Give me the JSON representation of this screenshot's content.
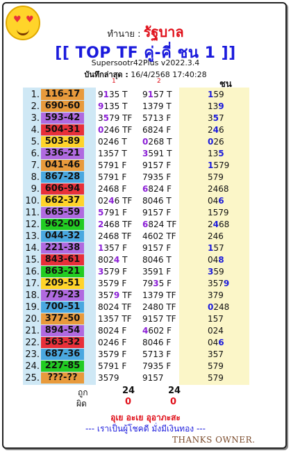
{
  "header": {
    "predictor_label": "ทำนาย :",
    "predictor_name": "รัฐบาล",
    "title": "[[ TOP TF คู่-คี่ ชน 1 ]]",
    "version": "Supersootr42Plus v2022.3.4",
    "saved_label": "บันทึกล่าสุด :",
    "saved_time": "16/4/2568 17:40:28",
    "col1_num": "1",
    "col2_num": "2",
    "chon_label": "ชน"
  },
  "rows": [
    {
      "idx": "1.",
      "pair": "116-17",
      "color": "#e89a3c",
      "c1": [
        [
          "9",
          0
        ],
        [
          "1",
          1
        ],
        [
          "35 T",
          0
        ]
      ],
      "c2": [
        [
          "9",
          0
        ],
        [
          "1",
          1
        ],
        [
          "57 T",
          0
        ]
      ],
      "c3": [
        [
          "1",
          1
        ],
        [
          "59",
          0
        ]
      ]
    },
    {
      "idx": "2.",
      "pair": "690-60",
      "color": "#e89a3c",
      "c1": [
        [
          "9",
          1
        ],
        [
          "135 T",
          0
        ]
      ],
      "c2": [
        [
          "1379 T",
          0
        ]
      ],
      "c3": [
        [
          "13",
          0
        ],
        [
          "9",
          1
        ]
      ]
    },
    {
      "idx": "3.",
      "pair": "593-42",
      "color": "#b06ae0",
      "c1": [
        [
          "3",
          0
        ],
        [
          "5",
          1
        ],
        [
          "79 TF",
          0
        ]
      ],
      "c2": [
        [
          "5713 F",
          0
        ]
      ],
      "c3": [
        [
          "3",
          0
        ],
        [
          "5",
          1
        ],
        [
          "7",
          0
        ]
      ]
    },
    {
      "idx": "4.",
      "pair": "504-31",
      "color": "#e8303a",
      "c1": [
        [
          "0",
          1
        ],
        [
          "246 TF",
          0
        ]
      ],
      "c2": [
        [
          "6824 F",
          0
        ]
      ],
      "c3": [
        [
          "2",
          0
        ],
        [
          "4",
          1
        ],
        [
          "6",
          0
        ]
      ]
    },
    {
      "idx": "5.",
      "pair": "503-89",
      "color": "#ffd42a",
      "c1": [
        [
          "0246 T",
          0
        ]
      ],
      "c2": [
        [
          "0",
          1
        ],
        [
          "268 T",
          0
        ]
      ],
      "c3": [
        [
          "0",
          1
        ],
        [
          "26",
          0
        ]
      ]
    },
    {
      "idx": "6.",
      "pair": "336-21",
      "color": "#b06ae0",
      "c1": [
        [
          "1357 T",
          0
        ]
      ],
      "c2": [
        [
          "3",
          1
        ],
        [
          "591 T",
          0
        ]
      ],
      "c3": [
        [
          "13",
          0
        ],
        [
          "5",
          1
        ]
      ]
    },
    {
      "idx": "7.",
      "pair": "041-46",
      "color": "#e89a3c",
      "c1": [
        [
          "5791 F",
          0
        ]
      ],
      "c2": [
        [
          "9157 F",
          0
        ]
      ],
      "c3": [
        [
          "1",
          1
        ],
        [
          "579",
          0
        ]
      ]
    },
    {
      "idx": "8.",
      "pair": "867-28",
      "color": "#4aa8e0",
      "c1": [
        [
          "5791 F",
          0
        ]
      ],
      "c2": [
        [
          "7935 F",
          0
        ]
      ],
      "c3": [
        [
          "579",
          0
        ]
      ]
    },
    {
      "idx": "9.",
      "pair": "606-94",
      "color": "#e8303a",
      "c1": [
        [
          "2468 F",
          0
        ]
      ],
      "c2": [
        [
          "6",
          1
        ],
        [
          "824 F",
          0
        ]
      ],
      "c3": [
        [
          "2468",
          0
        ]
      ]
    },
    {
      "idx": "10.",
      "pair": "662-37",
      "color": "#ffd42a",
      "c1": [
        [
          "02",
          0
        ],
        [
          "4",
          1
        ],
        [
          "6 TF",
          0
        ]
      ],
      "c2": [
        [
          "8046 T",
          0
        ]
      ],
      "c3": [
        [
          "04",
          0
        ],
        [
          "6",
          1
        ]
      ]
    },
    {
      "idx": "11.",
      "pair": "665-59",
      "color": "#b06ae0",
      "c1": [
        [
          "5",
          1
        ],
        [
          "791 F",
          0
        ]
      ],
      "c2": [
        [
          "9157 F",
          0
        ]
      ],
      "c3": [
        [
          "1579",
          0
        ]
      ]
    },
    {
      "idx": "12.",
      "pair": "962-00",
      "color": "#22cc22",
      "c1": [
        [
          "2",
          1
        ],
        [
          "468 TF",
          0
        ]
      ],
      "c2": [
        [
          "6",
          1
        ],
        [
          "824 TF",
          0
        ]
      ],
      "c3": [
        [
          "2",
          0
        ],
        [
          "4",
          1
        ],
        [
          "68",
          0
        ]
      ]
    },
    {
      "idx": "13.",
      "pair": "044-32",
      "color": "#4aa8e0",
      "c1": [
        [
          "2468 TF",
          0
        ]
      ],
      "c2": [
        [
          "4602 TF",
          0
        ]
      ],
      "c3": [
        [
          "246",
          0
        ]
      ]
    },
    {
      "idx": "14.",
      "pair": "221-38",
      "color": "#b06ae0",
      "c1": [
        [
          "1",
          1
        ],
        [
          "357 F",
          0
        ]
      ],
      "c2": [
        [
          "9157 F",
          0
        ]
      ],
      "c3": [
        [
          "1",
          1
        ],
        [
          "57",
          0
        ]
      ]
    },
    {
      "idx": "15.",
      "pair": "843-61",
      "color": "#e8303a",
      "c1": [
        [
          "802",
          0
        ],
        [
          "4",
          1
        ],
        [
          " T",
          0
        ]
      ],
      "c2": [
        [
          "8046 T",
          0
        ]
      ],
      "c3": [
        [
          "04",
          0
        ],
        [
          "8",
          1
        ]
      ]
    },
    {
      "idx": "16.",
      "pair": "863-21",
      "color": "#22cc22",
      "c1": [
        [
          "3",
          1
        ],
        [
          "579 F",
          0
        ]
      ],
      "c2": [
        [
          "3591 F",
          0
        ]
      ],
      "c3": [
        [
          "3",
          1
        ],
        [
          "59",
          0
        ]
      ]
    },
    {
      "idx": "17.",
      "pair": "209-51",
      "color": "#ffd42a",
      "c1": [
        [
          "3579 F",
          0
        ]
      ],
      "c2": [
        [
          "79",
          0
        ],
        [
          "3",
          1
        ],
        [
          "5 F",
          0
        ]
      ],
      "c3": [
        [
          "357",
          0
        ],
        [
          "9",
          1
        ]
      ]
    },
    {
      "idx": "18.",
      "pair": "779-23",
      "color": "#b06ae0",
      "c1": [
        [
          "357",
          0
        ],
        [
          "9",
          1
        ],
        [
          " TF",
          0
        ]
      ],
      "c2": [
        [
          "1379 TF",
          0
        ]
      ],
      "c3": [
        [
          "379",
          0
        ]
      ]
    },
    {
      "idx": "19.",
      "pair": "700-51",
      "color": "#4aa8e0",
      "c1": [
        [
          "8024 TF",
          0
        ]
      ],
      "c2": [
        [
          "2480 TF",
          0
        ]
      ],
      "c3": [
        [
          "0",
          1
        ],
        [
          "248",
          0
        ]
      ]
    },
    {
      "idx": "20.",
      "pair": "377-50",
      "color": "#e89a3c",
      "c1": [
        [
          "1357 TF",
          0
        ]
      ],
      "c2": [
        [
          "9157 TF",
          0
        ]
      ],
      "c3": [
        [
          "157",
          0
        ]
      ]
    },
    {
      "idx": "21.",
      "pair": "894-54",
      "color": "#b06ae0",
      "c1": [
        [
          "8024 F",
          0
        ]
      ],
      "c2": [
        [
          "4",
          1
        ],
        [
          "602 F",
          0
        ]
      ],
      "c3": [
        [
          "024",
          0
        ]
      ]
    },
    {
      "idx": "22.",
      "pair": "563-32",
      "color": "#e8303a",
      "c1": [
        [
          "0246 F",
          0
        ]
      ],
      "c2": [
        [
          "8046 F",
          0
        ]
      ],
      "c3": [
        [
          "04",
          0
        ],
        [
          "6",
          1
        ]
      ]
    },
    {
      "idx": "23.",
      "pair": "687-36",
      "color": "#4aa8e0",
      "c1": [
        [
          "3579 F",
          0
        ]
      ],
      "c2": [
        [
          "5713 F",
          0
        ]
      ],
      "c3": [
        [
          "357",
          0
        ]
      ]
    },
    {
      "idx": "24.",
      "pair": "227-85",
      "color": "#22cc22",
      "c1": [
        [
          "5791 F",
          0
        ]
      ],
      "c2": [
        [
          "7935 F",
          0
        ]
      ],
      "c3": [
        [
          "579",
          0
        ]
      ]
    },
    {
      "idx": "25.",
      "pair": "???-??",
      "color": "#e89a3c",
      "c1": [
        [
          "3579",
          0
        ]
      ],
      "c2": [
        [
          "9157",
          0
        ]
      ],
      "c3": [
        [
          "579",
          0
        ]
      ]
    }
  ],
  "summary": {
    "hit_label": "ถูก",
    "miss_label": "ผิด",
    "col1_hit": "24",
    "col2_hit": "24",
    "col1_miss": "0",
    "col2_miss": "0"
  },
  "footer": {
    "line1": "อุเย อะเย อุอาภะสะ",
    "line2": "--- เราเป็นผู้โชคดี มั่งมีเงินทอง ---",
    "thanks": "THANKS OWNER."
  },
  "colors": {
    "title_blue": "#1a1adc",
    "accent_red": "#e0101a",
    "hit_purple": "#8b1fd6",
    "left_bg": "#cfe8f5",
    "right_bg": "#fbf6c8"
  }
}
